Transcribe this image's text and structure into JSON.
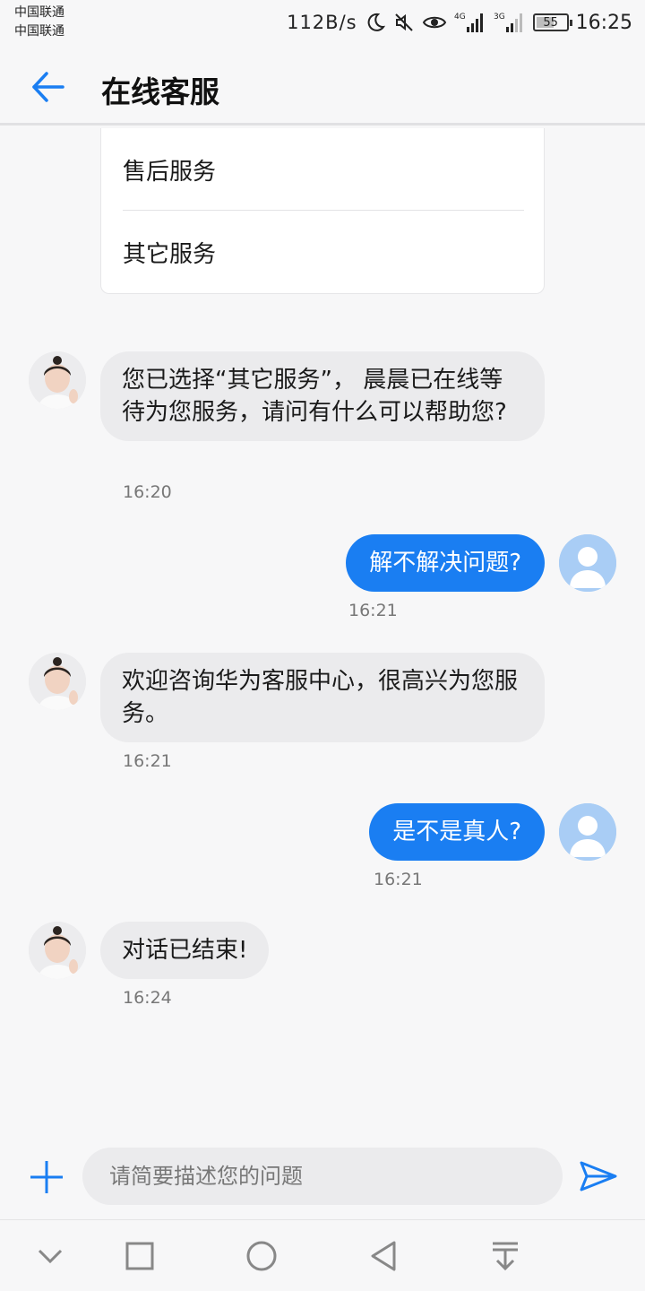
{
  "status_bar": {
    "carrier_1": "中国联通",
    "carrier_2": "中国联通",
    "speed": "112B/s",
    "net_1": "4G",
    "net_2": "3G",
    "battery": "55",
    "time": "16:25"
  },
  "header": {
    "title": "在线客服"
  },
  "menu": {
    "items": [
      {
        "label": "售后服务"
      },
      {
        "label": "其它服务"
      }
    ]
  },
  "messages": [
    {
      "from": "agent",
      "text": "您已选择“其它服务”， 晨晨已在线等待为您服务，请问有什么可以帮助您?",
      "time": "16:20"
    },
    {
      "from": "user",
      "text": "解不解决问题?",
      "time": "16:21"
    },
    {
      "from": "agent",
      "text": "欢迎咨询华为客服中心，很高兴为您服务。",
      "time": "16:21"
    },
    {
      "from": "user",
      "text": "是不是真人?",
      "time": "16:21"
    },
    {
      "from": "agent",
      "text": "对话已结束!",
      "time": "16:24"
    }
  ],
  "composer": {
    "placeholder": "请简要描述您的问题"
  },
  "colors": {
    "accent": "#1a7ef2",
    "incoming_bubble": "#ebebed",
    "background": "#f7f7f8",
    "user_avatar": "#a9cdf5"
  },
  "icons": {
    "back": "arrow-left-icon",
    "add": "plus-icon",
    "send": "send-icon",
    "nav": [
      "chevron-down-icon",
      "square-icon",
      "circle-icon",
      "triangle-back-icon",
      "pull-down-icon"
    ]
  }
}
